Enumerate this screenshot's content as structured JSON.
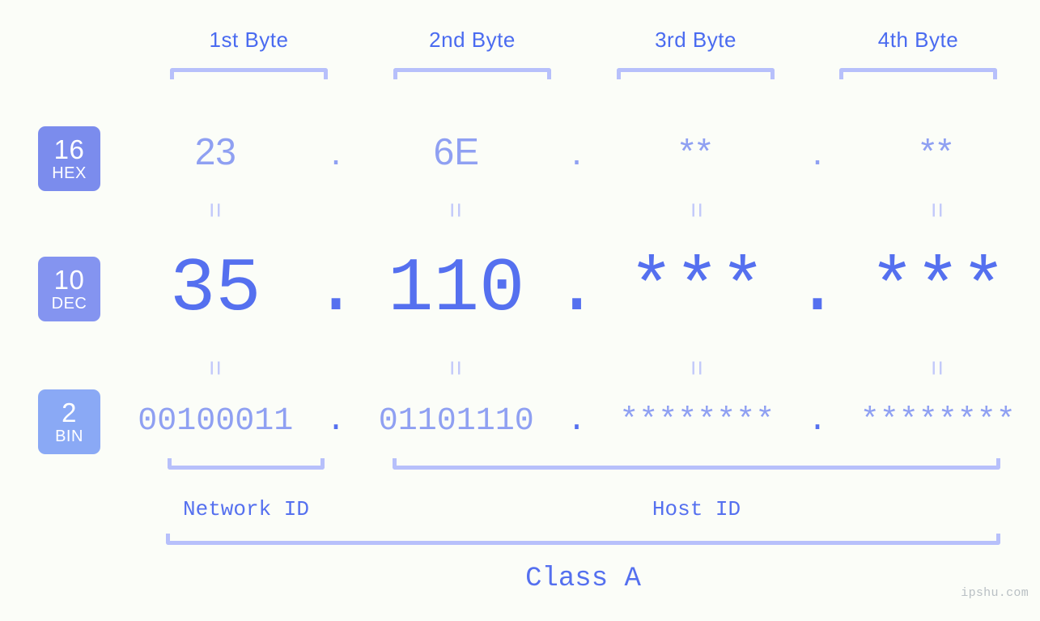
{
  "page": {
    "background_color": "#fbfdf8",
    "accent_color": "#5570ef",
    "accent_light_color": "#8fa0f2",
    "bracket_color": "#b7c0fb",
    "watermark": "ipshu.com"
  },
  "byte_headers": [
    {
      "label": "1st Byte"
    },
    {
      "label": "2nd Byte"
    },
    {
      "label": "3rd Byte"
    },
    {
      "label": "4th Byte"
    }
  ],
  "bases": [
    {
      "num": "16",
      "abbr": "HEX",
      "color": "#7b8ced"
    },
    {
      "num": "10",
      "abbr": "DEC",
      "color": "#8494f0"
    },
    {
      "num": "2",
      "abbr": "BIN",
      "color": "#8aa9f5"
    }
  ],
  "rows": {
    "hex": {
      "base_num": "16",
      "base_abbr": "HEX",
      "values": [
        "23",
        "6E",
        "**",
        "**"
      ],
      "separators": [
        ".",
        ".",
        "."
      ]
    },
    "dec": {
      "base_num": "10",
      "base_abbr": "DEC",
      "values": [
        "35",
        "110",
        "***",
        "***"
      ],
      "separators": [
        ".",
        ".",
        "."
      ]
    },
    "bin": {
      "base_num": "2",
      "base_abbr": "BIN",
      "values": [
        "00100011",
        "01101110",
        "********",
        "********"
      ],
      "separators": [
        ".",
        ".",
        "."
      ]
    }
  },
  "equals": {
    "glyph": "=",
    "hex_to_dec": [
      "=",
      "=",
      "=",
      "="
    ],
    "dec_to_bin": [
      "=",
      "=",
      "=",
      "="
    ]
  },
  "sections": [
    {
      "label": "Network ID"
    },
    {
      "label": "Host ID"
    }
  ],
  "class": {
    "label": "Class A"
  }
}
